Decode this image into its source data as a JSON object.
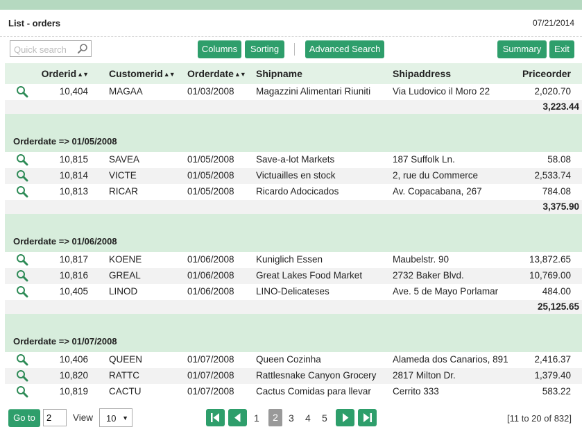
{
  "header": {
    "title": "List - orders",
    "date": "07/21/2014"
  },
  "toolbar": {
    "search_placeholder": "Quick search",
    "columns": "Columns",
    "sorting": "Sorting",
    "advanced_search": "Advanced Search",
    "summary": "Summary",
    "exit": "Exit"
  },
  "grid": {
    "headers": {
      "orderid": "Orderid",
      "customerid": "Customerid",
      "orderdate": "Orderdate",
      "shipname": "Shipname",
      "shipaddress": "Shipaddress",
      "priceorder": "Priceorder"
    },
    "sort_glyph": "▲▼",
    "groups": [
      {
        "title": "",
        "rows": [
          {
            "orderid": "10,404",
            "customerid": "MAGAA",
            "orderdate": "01/03/2008",
            "shipname": "Magazzini Alimentari Riuniti",
            "shipaddress": "Via Ludovico il Moro 22",
            "priceorder": "2,020.70"
          }
        ],
        "subtotal": "3,223.44"
      },
      {
        "title": "Orderdate => 01/05/2008",
        "rows": [
          {
            "orderid": "10,815",
            "customerid": "SAVEA",
            "orderdate": "01/05/2008",
            "shipname": "Save-a-lot Markets",
            "shipaddress": "187 Suffolk Ln.",
            "priceorder": "58.08"
          },
          {
            "orderid": "10,814",
            "customerid": "VICTE",
            "orderdate": "01/05/2008",
            "shipname": "Victuailles en stock",
            "shipaddress": "2, rue du Commerce",
            "priceorder": "2,533.74"
          },
          {
            "orderid": "10,813",
            "customerid": "RICAR",
            "orderdate": "01/05/2008",
            "shipname": "Ricardo Adocicados",
            "shipaddress": "Av. Copacabana, 267",
            "priceorder": "784.08"
          }
        ],
        "subtotal": "3,375.90"
      },
      {
        "title": "Orderdate => 01/06/2008",
        "rows": [
          {
            "orderid": "10,817",
            "customerid": "KOENE",
            "orderdate": "01/06/2008",
            "shipname": "Kuniglich Essen",
            "shipaddress": "Maubelstr. 90",
            "priceorder": "13,872.65"
          },
          {
            "orderid": "10,816",
            "customerid": "GREAL",
            "orderdate": "01/06/2008",
            "shipname": "Great Lakes Food Market",
            "shipaddress": "2732 Baker Blvd.",
            "priceorder": "10,769.00"
          },
          {
            "orderid": "10,405",
            "customerid": "LINOD",
            "orderdate": "01/06/2008",
            "shipname": "LINO-Delicateses",
            "shipaddress": "Ave. 5 de Mayo Porlamar",
            "priceorder": "484.00"
          }
        ],
        "subtotal": "25,125.65"
      },
      {
        "title": "Orderdate => 01/07/2008",
        "rows": [
          {
            "orderid": "10,406",
            "customerid": "QUEEN",
            "orderdate": "01/07/2008",
            "shipname": "Queen Cozinha",
            "shipaddress": "Alameda dos Canarios, 891",
            "priceorder": "2,416.37"
          },
          {
            "orderid": "10,820",
            "customerid": "RATTC",
            "orderdate": "01/07/2008",
            "shipname": "Rattlesnake Canyon Grocery",
            "shipaddress": "2817 Milton Dr.",
            "priceorder": "1,379.40"
          },
          {
            "orderid": "10,819",
            "customerid": "CACTU",
            "orderdate": "01/07/2008",
            "shipname": "Cactus Comidas para llevar",
            "shipaddress": "Cerrito 333",
            "priceorder": "583.22"
          }
        ],
        "subtotal": ""
      }
    ]
  },
  "footer": {
    "goto_label": "Go to",
    "goto_value": "2",
    "view_label": "View",
    "view_value": "10",
    "pages": [
      "1",
      "2",
      "3",
      "4",
      "5"
    ],
    "current_page": "2",
    "range": "[11 to 20 of 832]"
  },
  "colors": {
    "accent": "#2e9e6b",
    "group_bg": "#d7eddc",
    "header_bg": "#e3f2e6",
    "top_band": "#b5d9c0"
  },
  "icons": {
    "search": "magnifier-icon",
    "view_row": "magnifier-icon",
    "first": "first-page-icon",
    "prev": "prev-page-icon",
    "next": "next-page-icon",
    "last": "last-page-icon"
  }
}
